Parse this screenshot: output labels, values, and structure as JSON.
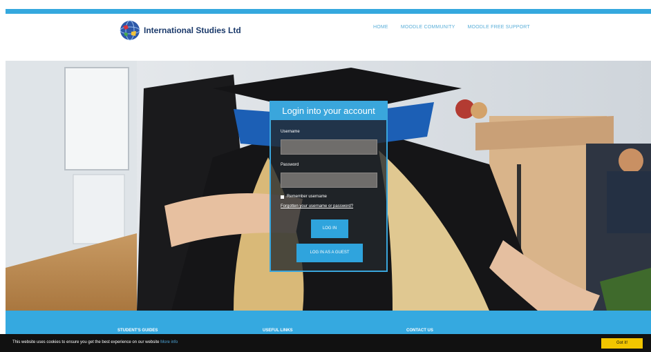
{
  "header": {
    "brand": "International Studies Ltd",
    "nav": [
      "HOME",
      "MOODLE COMMUNITY",
      "MOODLE FREE SUPPORT"
    ]
  },
  "login": {
    "title": "Login into your account",
    "username_label": "Username",
    "password_label": "Password",
    "remember_label": "Remember username",
    "forgot_link": "Forgotten your username or password?",
    "login_button": "LOG IN",
    "guest_button": "LOG IN AS A GUEST"
  },
  "footer": {
    "col1": "STUDENT'S GUIDES",
    "col2": "USEFUL LINKS",
    "col3": "CONTACT US"
  },
  "cookie": {
    "text": "This website uses cookies to ensure you get the best experience on our website",
    "more_info": "More info",
    "got_it": "Got it!"
  },
  "colors": {
    "accent": "#35a8de",
    "cookie_bar": "#111111",
    "got_it_bg": "#f2c500"
  }
}
